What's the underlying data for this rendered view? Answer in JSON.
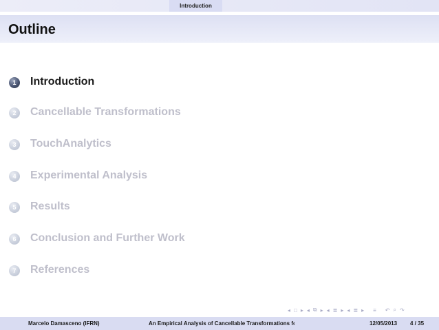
{
  "header": {
    "section_tab": "Introduction"
  },
  "frame": {
    "title": "Outline"
  },
  "toc": {
    "items": [
      {
        "number": "1",
        "label": "Introduction",
        "active": true
      },
      {
        "number": "2",
        "label": "Cancellable Transformations",
        "active": false
      },
      {
        "number": "3",
        "label": "TouchAnalytics",
        "active": false
      },
      {
        "number": "4",
        "label": "Experimental Analysis",
        "active": false
      },
      {
        "number": "5",
        "label": "Results",
        "active": false
      },
      {
        "number": "6",
        "label": "Conclusion and Further Work",
        "active": false
      },
      {
        "number": "7",
        "label": "References",
        "active": false
      }
    ]
  },
  "nav_icons": [
    "prev-arrow-icon",
    "frame-icon",
    "next-arrow-icon",
    "prev-arrow-icon",
    "subsection-icon",
    "next-arrow-icon",
    "prev-arrow-icon",
    "section-icon",
    "next-arrow-icon",
    "prev-arrow-icon",
    "section-icon",
    "next-arrow-icon",
    "align-icon",
    "undo-icon",
    "redo-icon"
  ],
  "footer": {
    "author": "Marcelo Damasceno  (IFRN)",
    "title": "An Empirical Analysis of Cancellable Transformations for TouchAnalytics",
    "date": "12/05/2013",
    "page": "4 / 35"
  },
  "colors": {
    "accent": "#4a5572",
    "dimmed_text": "#bfbfcb",
    "bar_background": "#d9dcf2"
  }
}
